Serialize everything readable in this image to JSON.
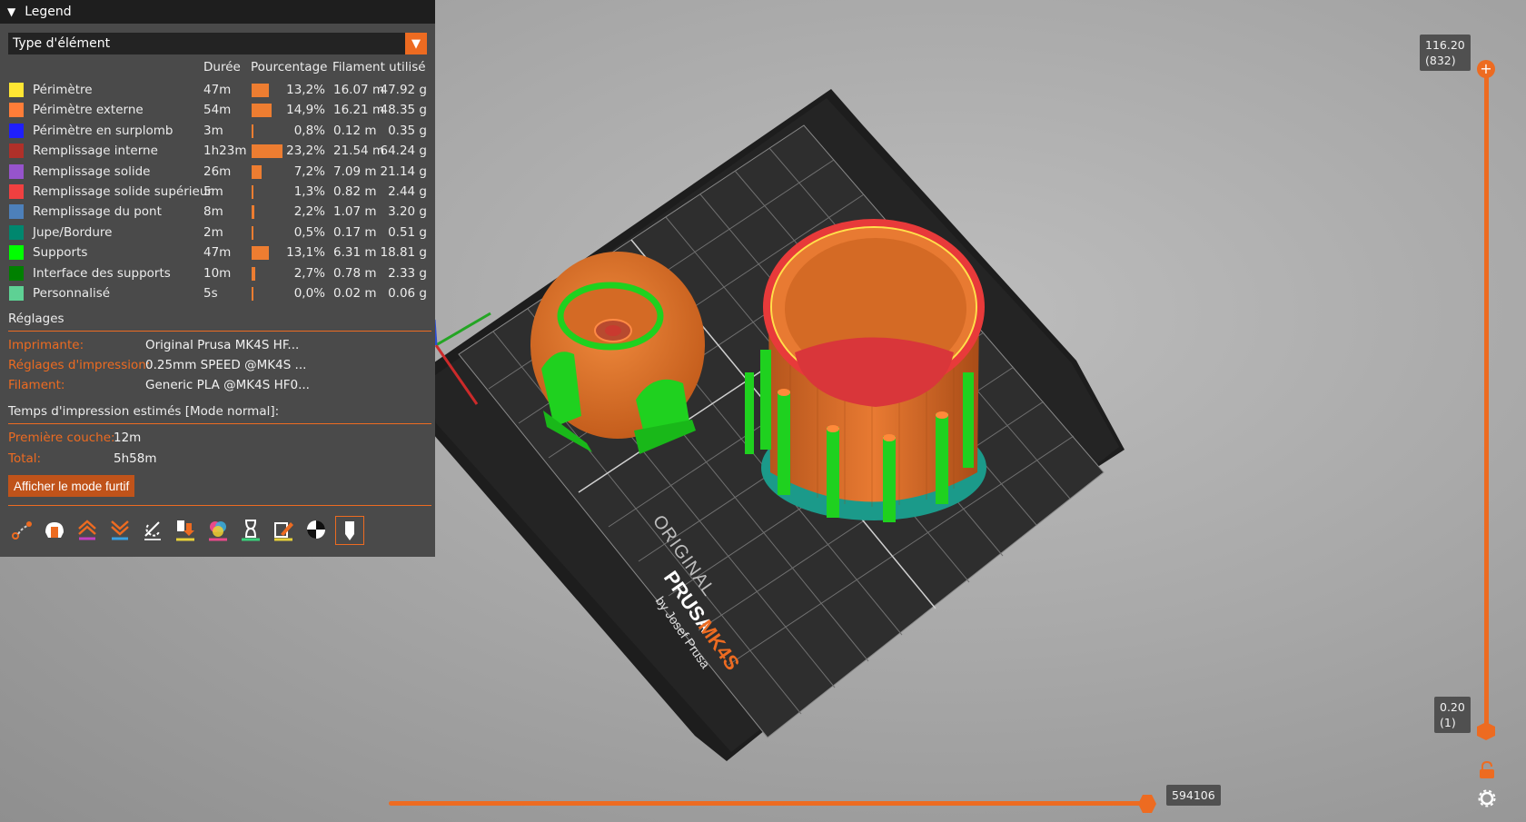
{
  "legend": {
    "title": "Legend",
    "view_type": "Type d'élément",
    "columns": {
      "duration": "Durée",
      "percentage": "Pourcentage",
      "filament": "Filament utilisé"
    },
    "features": [
      {
        "name": "Périmètre",
        "color": "#ffe633",
        "duration": "47m",
        "percent_value": 13.2,
        "percent": "13,2%",
        "length": "16.07 m",
        "weight": "47.92 g"
      },
      {
        "name": "Périmètre externe",
        "color": "#ff7d38",
        "duration": "54m",
        "percent_value": 14.9,
        "percent": "14,9%",
        "length": "16.21 m",
        "weight": "48.35 g"
      },
      {
        "name": "Périmètre en surplomb",
        "color": "#1f1fff",
        "duration": "3m",
        "percent_value": 0.8,
        "percent": "0,8%",
        "length": "0.12 m",
        "weight": "0.35 g"
      },
      {
        "name": "Remplissage interne",
        "color": "#b03029",
        "duration": "1h23m",
        "percent_value": 23.2,
        "percent": "23,2%",
        "length": "21.54 m",
        "weight": "64.24 g"
      },
      {
        "name": "Remplissage solide",
        "color": "#9654cc",
        "duration": "26m",
        "percent_value": 7.2,
        "percent": "7,2%",
        "length": "7.09 m",
        "weight": "21.14 g"
      },
      {
        "name": "Remplissage solide supérieur",
        "color": "#f04040",
        "duration": "5m",
        "percent_value": 1.3,
        "percent": "1,3%",
        "length": "0.82 m",
        "weight": "2.44 g"
      },
      {
        "name": "Remplissage du pont",
        "color": "#4d80ba",
        "duration": "8m",
        "percent_value": 2.2,
        "percent": "2,2%",
        "length": "1.07 m",
        "weight": "3.20 g"
      },
      {
        "name": "Jupe/Bordure",
        "color": "#00876e",
        "duration": "2m",
        "percent_value": 0.5,
        "percent": "0,5%",
        "length": "0.17 m",
        "weight": "0.51 g"
      },
      {
        "name": "Supports",
        "color": "#00ff00",
        "duration": "47m",
        "percent_value": 13.1,
        "percent": "13,1%",
        "length": "6.31 m",
        "weight": "18.81 g"
      },
      {
        "name": "Interface des supports",
        "color": "#008000",
        "duration": "10m",
        "percent_value": 2.7,
        "percent": "2,7%",
        "length": "0.78 m",
        "weight": "2.33 g"
      },
      {
        "name": "Personnalisé",
        "color": "#5ed194",
        "duration": "5s",
        "percent_value": 0.0,
        "percent": "0,0%",
        "length": "0.02 m",
        "weight": "0.06 g"
      }
    ],
    "settings": {
      "title": "Réglages",
      "printer_label": "Imprimante:",
      "printer_value": "Original Prusa MK4S HF...",
      "print_label": "Réglages d'impression:",
      "print_value": "0.25mm SPEED @MK4S ...",
      "filament_label": "Filament:",
      "filament_value": "Generic PLA @MK4S HF0..."
    },
    "times": {
      "title": "Temps d'impression estimés [Mode normal]:",
      "first_layer_label": "Première couche:",
      "first_layer_value": "12m",
      "total_label": "Total:",
      "total_value": "5h58m"
    },
    "stealth_button": "Afficher le mode furtif",
    "view_options": [
      "travel-icon",
      "wipe-icon",
      "retractions-icon",
      "deretractions-icon",
      "seams-icon",
      "tool-changes-icon",
      "color-changes-icon",
      "pause-icon",
      "custom-gcode-icon",
      "center-of-gravity-icon",
      "shells-icon"
    ]
  },
  "bed": {
    "brand_line1": "ORIGINAL",
    "brand_line2": "PRUSA",
    "model": "MK4S",
    "maker": "by Josef Prusa"
  },
  "vertical_slider": {
    "top_height": "116.20",
    "top_layer": "(832)",
    "bottom_height": "0.20",
    "bottom_layer": "(1)"
  },
  "horizontal_slider": {
    "value": "594106",
    "position_fraction": 1.0
  },
  "colors": {
    "accent": "#ed6b21",
    "panel": "#4a4a4a"
  }
}
